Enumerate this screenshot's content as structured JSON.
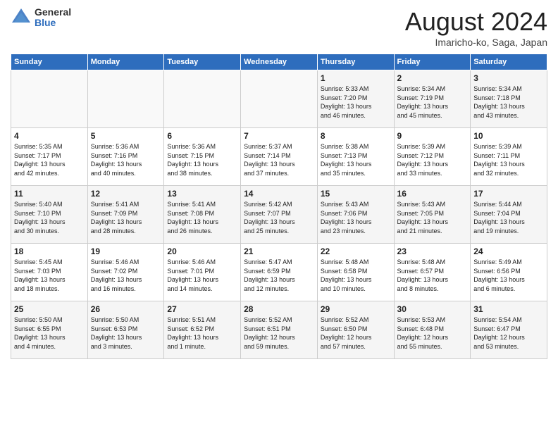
{
  "header": {
    "logo_general": "General",
    "logo_blue": "Blue",
    "month": "August 2024",
    "location": "Imaricho-ko, Saga, Japan"
  },
  "weekdays": [
    "Sunday",
    "Monday",
    "Tuesday",
    "Wednesday",
    "Thursday",
    "Friday",
    "Saturday"
  ],
  "weeks": [
    [
      {
        "day": "",
        "info": ""
      },
      {
        "day": "",
        "info": ""
      },
      {
        "day": "",
        "info": ""
      },
      {
        "day": "",
        "info": ""
      },
      {
        "day": "1",
        "info": "Sunrise: 5:33 AM\nSunset: 7:20 PM\nDaylight: 13 hours\nand 46 minutes."
      },
      {
        "day": "2",
        "info": "Sunrise: 5:34 AM\nSunset: 7:19 PM\nDaylight: 13 hours\nand 45 minutes."
      },
      {
        "day": "3",
        "info": "Sunrise: 5:34 AM\nSunset: 7:18 PM\nDaylight: 13 hours\nand 43 minutes."
      }
    ],
    [
      {
        "day": "4",
        "info": "Sunrise: 5:35 AM\nSunset: 7:17 PM\nDaylight: 13 hours\nand 42 minutes."
      },
      {
        "day": "5",
        "info": "Sunrise: 5:36 AM\nSunset: 7:16 PM\nDaylight: 13 hours\nand 40 minutes."
      },
      {
        "day": "6",
        "info": "Sunrise: 5:36 AM\nSunset: 7:15 PM\nDaylight: 13 hours\nand 38 minutes."
      },
      {
        "day": "7",
        "info": "Sunrise: 5:37 AM\nSunset: 7:14 PM\nDaylight: 13 hours\nand 37 minutes."
      },
      {
        "day": "8",
        "info": "Sunrise: 5:38 AM\nSunset: 7:13 PM\nDaylight: 13 hours\nand 35 minutes."
      },
      {
        "day": "9",
        "info": "Sunrise: 5:39 AM\nSunset: 7:12 PM\nDaylight: 13 hours\nand 33 minutes."
      },
      {
        "day": "10",
        "info": "Sunrise: 5:39 AM\nSunset: 7:11 PM\nDaylight: 13 hours\nand 32 minutes."
      }
    ],
    [
      {
        "day": "11",
        "info": "Sunrise: 5:40 AM\nSunset: 7:10 PM\nDaylight: 13 hours\nand 30 minutes."
      },
      {
        "day": "12",
        "info": "Sunrise: 5:41 AM\nSunset: 7:09 PM\nDaylight: 13 hours\nand 28 minutes."
      },
      {
        "day": "13",
        "info": "Sunrise: 5:41 AM\nSunset: 7:08 PM\nDaylight: 13 hours\nand 26 minutes."
      },
      {
        "day": "14",
        "info": "Sunrise: 5:42 AM\nSunset: 7:07 PM\nDaylight: 13 hours\nand 25 minutes."
      },
      {
        "day": "15",
        "info": "Sunrise: 5:43 AM\nSunset: 7:06 PM\nDaylight: 13 hours\nand 23 minutes."
      },
      {
        "day": "16",
        "info": "Sunrise: 5:43 AM\nSunset: 7:05 PM\nDaylight: 13 hours\nand 21 minutes."
      },
      {
        "day": "17",
        "info": "Sunrise: 5:44 AM\nSunset: 7:04 PM\nDaylight: 13 hours\nand 19 minutes."
      }
    ],
    [
      {
        "day": "18",
        "info": "Sunrise: 5:45 AM\nSunset: 7:03 PM\nDaylight: 13 hours\nand 18 minutes."
      },
      {
        "day": "19",
        "info": "Sunrise: 5:46 AM\nSunset: 7:02 PM\nDaylight: 13 hours\nand 16 minutes."
      },
      {
        "day": "20",
        "info": "Sunrise: 5:46 AM\nSunset: 7:01 PM\nDaylight: 13 hours\nand 14 minutes."
      },
      {
        "day": "21",
        "info": "Sunrise: 5:47 AM\nSunset: 6:59 PM\nDaylight: 13 hours\nand 12 minutes."
      },
      {
        "day": "22",
        "info": "Sunrise: 5:48 AM\nSunset: 6:58 PM\nDaylight: 13 hours\nand 10 minutes."
      },
      {
        "day": "23",
        "info": "Sunrise: 5:48 AM\nSunset: 6:57 PM\nDaylight: 13 hours\nand 8 minutes."
      },
      {
        "day": "24",
        "info": "Sunrise: 5:49 AM\nSunset: 6:56 PM\nDaylight: 13 hours\nand 6 minutes."
      }
    ],
    [
      {
        "day": "25",
        "info": "Sunrise: 5:50 AM\nSunset: 6:55 PM\nDaylight: 13 hours\nand 4 minutes."
      },
      {
        "day": "26",
        "info": "Sunrise: 5:50 AM\nSunset: 6:53 PM\nDaylight: 13 hours\nand 3 minutes."
      },
      {
        "day": "27",
        "info": "Sunrise: 5:51 AM\nSunset: 6:52 PM\nDaylight: 13 hours\nand 1 minute."
      },
      {
        "day": "28",
        "info": "Sunrise: 5:52 AM\nSunset: 6:51 PM\nDaylight: 12 hours\nand 59 minutes."
      },
      {
        "day": "29",
        "info": "Sunrise: 5:52 AM\nSunset: 6:50 PM\nDaylight: 12 hours\nand 57 minutes."
      },
      {
        "day": "30",
        "info": "Sunrise: 5:53 AM\nSunset: 6:48 PM\nDaylight: 12 hours\nand 55 minutes."
      },
      {
        "day": "31",
        "info": "Sunrise: 5:54 AM\nSunset: 6:47 PM\nDaylight: 12 hours\nand 53 minutes."
      }
    ]
  ]
}
